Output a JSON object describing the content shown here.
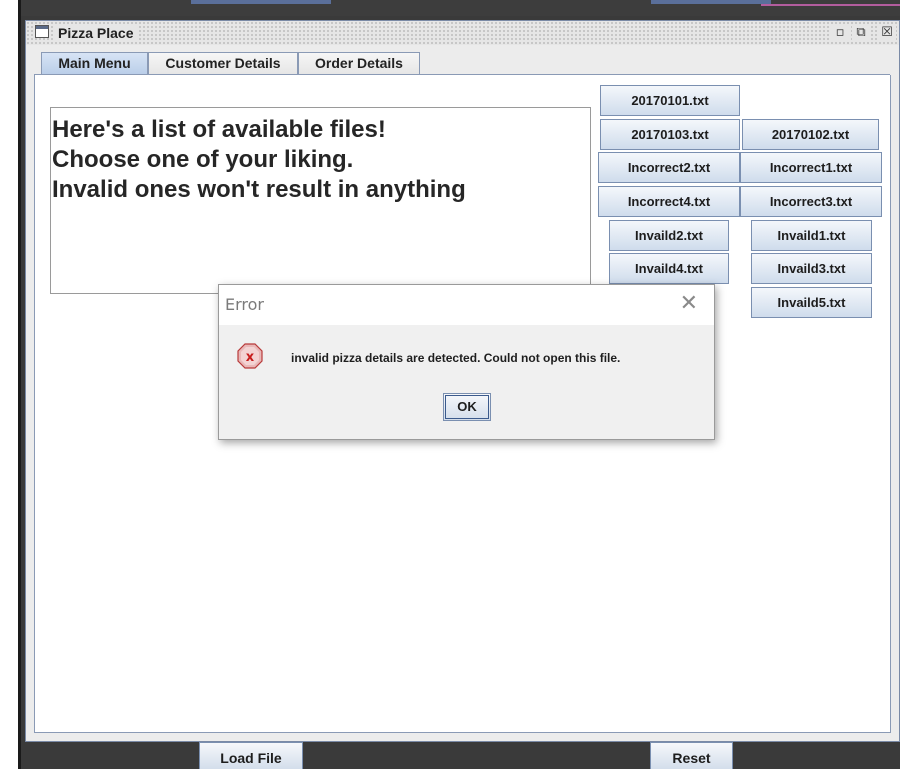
{
  "window": {
    "title": "Pizza Place",
    "controls": {
      "minimize": "▫",
      "maximize": "⧉",
      "close": "☒"
    }
  },
  "tabs": [
    {
      "label": "Main Menu",
      "active": true
    },
    {
      "label": "Customer Details",
      "active": false
    },
    {
      "label": "Order Details",
      "active": false
    }
  ],
  "message_lines": [
    "Here's a list of available files!",
    "Choose one of your liking.",
    "Invalid ones won't result in anything"
  ],
  "files": {
    "f20170101": "20170101.txt",
    "f20170103": "20170103.txt",
    "f20170102": "20170102.txt",
    "incorrect2": "Incorrect2.txt",
    "incorrect1": "Incorrect1.txt",
    "incorrect4": "Incorrect4.txt",
    "incorrect3": "Incorrect3.txt",
    "invaild2": "Invaild2.txt",
    "invaild1": "Invaild1.txt",
    "invaild4": "Invaild4.txt",
    "invaild3": "Invaild3.txt",
    "invaild5": "Invaild5.txt"
  },
  "dialog": {
    "title": "Error",
    "message": "invalid pizza details are detected. Could not open this file.",
    "ok_label": "OK",
    "close_glyph": "✕"
  },
  "bottom": {
    "load_label": "Load File",
    "reset_label": "Reset"
  },
  "colors": {
    "button_border": "#7a8fb0",
    "active_tab": "#b9cde8",
    "error_red": "#d9373b"
  }
}
